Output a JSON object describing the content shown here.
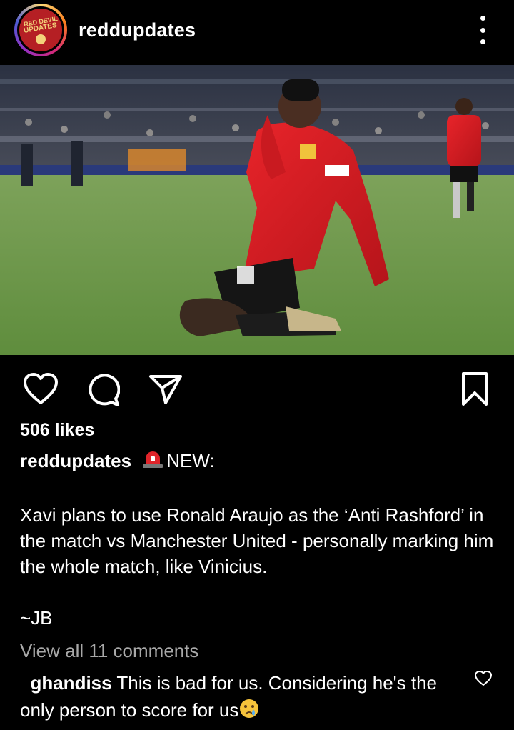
{
  "header": {
    "username": "reddupdates",
    "avatar_text_line1": "RED DEVIL",
    "avatar_text_line2": "UPDATES"
  },
  "post": {
    "likes": "506 likes",
    "caption": {
      "username": "reddupdates",
      "tag": "NEW:",
      "body": "Xavi plans to use Ronald Araujo as the ‘Anti Rashford’ in the match vs Manchester United - personally marking him the whole match, like Vinicius.",
      "signature": "~JB"
    },
    "view_all_comments": "View all 11 comments",
    "comment": {
      "username": "_ghandiss",
      "text": "This is bad for us. Considering he's the only person to score for us"
    }
  },
  "icons": {
    "like": "heart-icon",
    "comment": "comment-bubble-icon",
    "share": "paper-plane-icon",
    "save": "bookmark-icon",
    "more": "more-vertical-icon",
    "siren": "siren-emoji-icon",
    "crying": "crying-face-emoji-icon"
  },
  "colors": {
    "background": "#000000",
    "text": "#ffffff",
    "muted_text": "#a8a8a8",
    "jersey_red": "#d7191f"
  }
}
